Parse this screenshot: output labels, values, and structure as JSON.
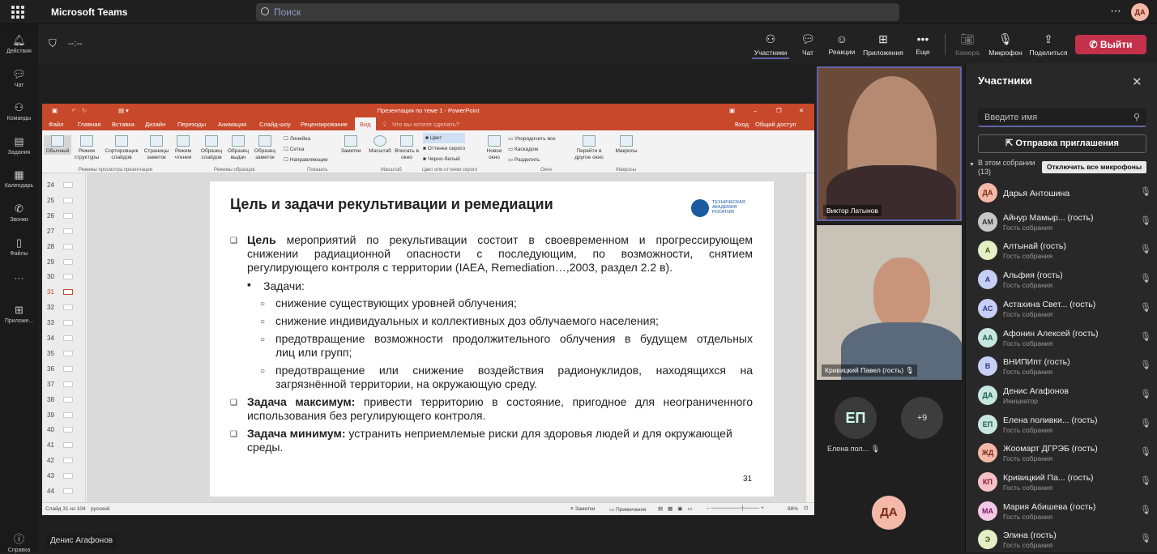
{
  "app": {
    "title": "Microsoft Teams",
    "search_placeholder": "Поиск",
    "me_initials": "ДА"
  },
  "rail": [
    {
      "icon": "bell-icon",
      "label": "Действия"
    },
    {
      "icon": "chat-icon",
      "label": "Чат"
    },
    {
      "icon": "teams-icon",
      "label": "Команды"
    },
    {
      "icon": "tasks-icon",
      "label": "Задания"
    },
    {
      "icon": "calendar-icon",
      "label": "Календарь"
    },
    {
      "icon": "phone-icon",
      "label": "Звонки"
    },
    {
      "icon": "files-icon",
      "label": "Файлы"
    },
    {
      "icon": "more-icon",
      "label": "···"
    },
    {
      "icon": "apps-icon",
      "label": "Приложе..."
    },
    {
      "icon": "help-icon",
      "label": "Справка"
    }
  ],
  "callbar": {
    "timer": "--:--",
    "buttons": [
      {
        "icon": "people-icon",
        "label": "Участники"
      },
      {
        "icon": "chat-icon",
        "label": "Чат"
      },
      {
        "icon": "reaction-icon",
        "label": "Реакции"
      },
      {
        "icon": "apps-add-icon",
        "label": "Приложения"
      },
      {
        "icon": "more-icon",
        "label": "Еще"
      },
      {
        "icon": "camera-off-icon",
        "label": "Камера"
      },
      {
        "icon": "mic-off-icon",
        "label": "Микрофон"
      },
      {
        "icon": "share-icon",
        "label": "Поделиться"
      }
    ],
    "leave": "Выйти"
  },
  "ppt": {
    "title": "Презентация по теме 1 - PowerPoint",
    "menu": [
      "Файл",
      "Главная",
      "Вставка",
      "Дизайн",
      "Переходы",
      "Анимация",
      "Слайд-шоу",
      "Рецензирование",
      "Вид"
    ],
    "tellme": "Что вы хотите сделать?",
    "login": "Вход",
    "share": "Общий доступ",
    "ribbon": [
      "Обычный",
      "Режим структуры",
      "Сортировщик слайдов",
      "Страницы заметок",
      "Режим чтения",
      "Образец слайдов",
      "Образец выдач",
      "Образец заметок",
      "Заметки",
      "Масштаб",
      "Вписать в окно",
      "Новое окно",
      "Перейти в другое окно",
      "Макросы"
    ],
    "checks": [
      "Линейка",
      "Сетка",
      "Направляющие"
    ],
    "color_opts": [
      "Цвет",
      "Оттенки серого",
      "Черно-белый"
    ],
    "window_opts": [
      "Упорядочить все",
      "Каскадом",
      "Разделить"
    ],
    "groups": [
      "Режимы просмотра презентации",
      "Режимы образцов",
      "Показать",
      "Масштаб",
      "Цвет или оттенки серого",
      "Окно",
      "Макросы"
    ],
    "status_left": "Слайд 31 из 104",
    "status_lang": "русский",
    "status_notes": "Заметки",
    "status_comments": "Примечания",
    "zoom": "88%",
    "thumbs": [
      "24",
      "25",
      "26",
      "27",
      "28",
      "29",
      "30",
      "31",
      "32",
      "33",
      "34",
      "35",
      "36",
      "37",
      "38",
      "39",
      "40",
      "41",
      "42",
      "43",
      "44"
    ]
  },
  "slide": {
    "title": "Цель и задачи рекультивации и ремедиации",
    "logo_text": "ТЕХНИЧЕСКАЯ АКАДЕМИЯ РОСАТОМ",
    "goal_lead": "Цель",
    "goal_line1": "мероприятий по рекультивации состоит в своевременном и прогрессирующем",
    "goal_line2": "снижении радиационной опасности с последующим, по возможности, снятием",
    "goal_line3": "регулирующего контроля с территории (IAEA, Remediation…,2003, раздел 2.2 в).",
    "tasks_label": "Задачи:",
    "t1": "снижение существующих уровней облучения;",
    "t2": "снижение индивидуальных и коллективных доз облучаемого населения;",
    "t3a": "предотвращение возможности продолжительного облучения в будущем отдельных",
    "t3b": "лиц или групп;",
    "t4a": "предотвращение или снижение воздействия радионуклидов, находящихся на",
    "t4b": "загрязнённой территории, на окружающую среду.",
    "max_lead": "Задача максимум:",
    "max_text1": "привести территорию в состояние, пригодное для неограниченного",
    "max_text2": "использования без регулирующего контроля.",
    "min_lead": "Задача минимум:",
    "min_text1": "устранить неприемлемые риски для здоровья людей и для окружающей",
    "min_text2": "среды.",
    "page": "31"
  },
  "presenter": "Денис Агафонов",
  "tiles": {
    "t1": "Виктор Латынов",
    "t2": "Кривицкий Павел (гость)",
    "ep_initials": "ЕП",
    "ep_name": "Елена пол...",
    "more": "+9",
    "da_initials": "ДА"
  },
  "panel": {
    "title": "Участники",
    "search_placeholder": "Введите имя",
    "invite": "Отправка приглашения",
    "in_meeting": "В этом собрании (13)",
    "mute_all": "Отключить все микрофоны",
    "people": [
      {
        "initials": "ДА",
        "name": "Дарья Антошина",
        "role": "",
        "color": "#f3b8a8",
        "fg": "#7a2a16"
      },
      {
        "initials": "АМ",
        "name": "Айнур Мамыр...  (гость)",
        "role": "Гость собрания",
        "color": "#c8c8c8",
        "fg": "#333"
      },
      {
        "initials": "А",
        "name": "Алтынай (гость)",
        "role": "Гость собрания",
        "color": "#e3efc4",
        "fg": "#4a5a1a"
      },
      {
        "initials": "А",
        "name": "Альфия (гость)",
        "role": "Гость собрания",
        "color": "#c6cff5",
        "fg": "#2a3a8a"
      },
      {
        "initials": "АС",
        "name": "Астахина Свет...  (гость)",
        "role": "Гость собрания",
        "color": "#c6cff5",
        "fg": "#2a3a8a"
      },
      {
        "initials": "АА",
        "name": "Афонин Алексей (гость)",
        "role": "Гость собрания",
        "color": "#c8e6e0",
        "fg": "#1a5a4a"
      },
      {
        "initials": "В",
        "name": "ВНИПИпт (гость)",
        "role": "Гость собрания",
        "color": "#c6cff5",
        "fg": "#2a3a8a"
      },
      {
        "initials": "ДА",
        "name": "Денис Агафонов",
        "role": "Инициатор",
        "color": "#c8e6e0",
        "fg": "#1a5a4a"
      },
      {
        "initials": "ЕП",
        "name": "Елена поливки...  (гость)",
        "role": "Гость собрания",
        "color": "#c8e6e0",
        "fg": "#1a5a4a"
      },
      {
        "initials": "ЖД",
        "name": "Жоомарт ДГРЭБ (гость)",
        "role": "Гость собрания",
        "color": "#f3b8a8",
        "fg": "#7a2a16"
      },
      {
        "initials": "КП",
        "name": "Кривицкий Па...  (гость)",
        "role": "Гость собрания",
        "color": "#f4c1c8",
        "fg": "#8a1a2a"
      },
      {
        "initials": "МА",
        "name": "Мария Абишева (гость)",
        "role": "Гость собрания",
        "color": "#f3c8e6",
        "fg": "#7a1a5a"
      },
      {
        "initials": "Э",
        "name": "Элина (гость)",
        "role": "Гость собрания",
        "color": "#e3efc4",
        "fg": "#4a5a1a"
      }
    ]
  }
}
